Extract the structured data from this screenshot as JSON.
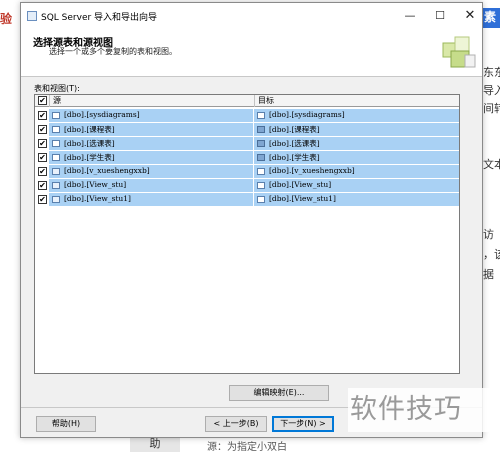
{
  "background": {
    "left_text": "验",
    "right_highlight": "素",
    "right_snippets": [
      "东东",
      "导入",
      "间转",
      "文本",
      "访",
      "，该",
      "据"
    ],
    "bottom_nav": "助",
    "bottom_text": "源：为指定小双白"
  },
  "watermark": "软件技巧",
  "window": {
    "title": "SQL Server 导入和导出向导",
    "minimize": "—",
    "maximize": "☐",
    "close": "✕"
  },
  "header": {
    "title": "选择源表和源视图",
    "subtitle": "选择一个或多个要复制的表和视图。"
  },
  "list": {
    "label": "表和视图(T):",
    "col_source": "源",
    "col_dest": "目标",
    "rows": [
      {
        "checked": "✔",
        "src_icon": "table-icon",
        "src": "[dbo].[sysdiagrams]",
        "dst": "[dbo].[sysdiagrams]"
      },
      {
        "checked": "✔",
        "src_icon": "table-icon",
        "src": "[dbo].[课程表]",
        "dst": "[dbo].[课程表]"
      },
      {
        "checked": "✔",
        "src_icon": "table-icon",
        "src": "[dbo].[选课表]",
        "dst": "[dbo].[选课表]"
      },
      {
        "checked": "✔",
        "src_icon": "table-icon",
        "src": "[dbo].[学生表]",
        "dst": "[dbo].[学生表]"
      },
      {
        "checked": "✔",
        "src_icon": "view-icon",
        "src": "[dbo].[v_xueshengxxb]",
        "dst": "[dbo].[v_xueshengxxb]"
      },
      {
        "checked": "✔",
        "src_icon": "view-icon",
        "src": "[dbo].[View_stu]",
        "dst": "[dbo].[View_stu]"
      },
      {
        "checked": "✔",
        "src_icon": "view-icon",
        "src": "[dbo].[View_stu1]",
        "dst": "[dbo].[View_stu1]"
      }
    ]
  },
  "buttons": {
    "edit_mapping": "编辑映射(E)...",
    "help": "帮助(H)",
    "back": "< 上一步(B)",
    "next": "下一步(N) >"
  },
  "colors": {
    "row_highlight": "#a9d1f4",
    "default_button_border": "#0078d7"
  }
}
